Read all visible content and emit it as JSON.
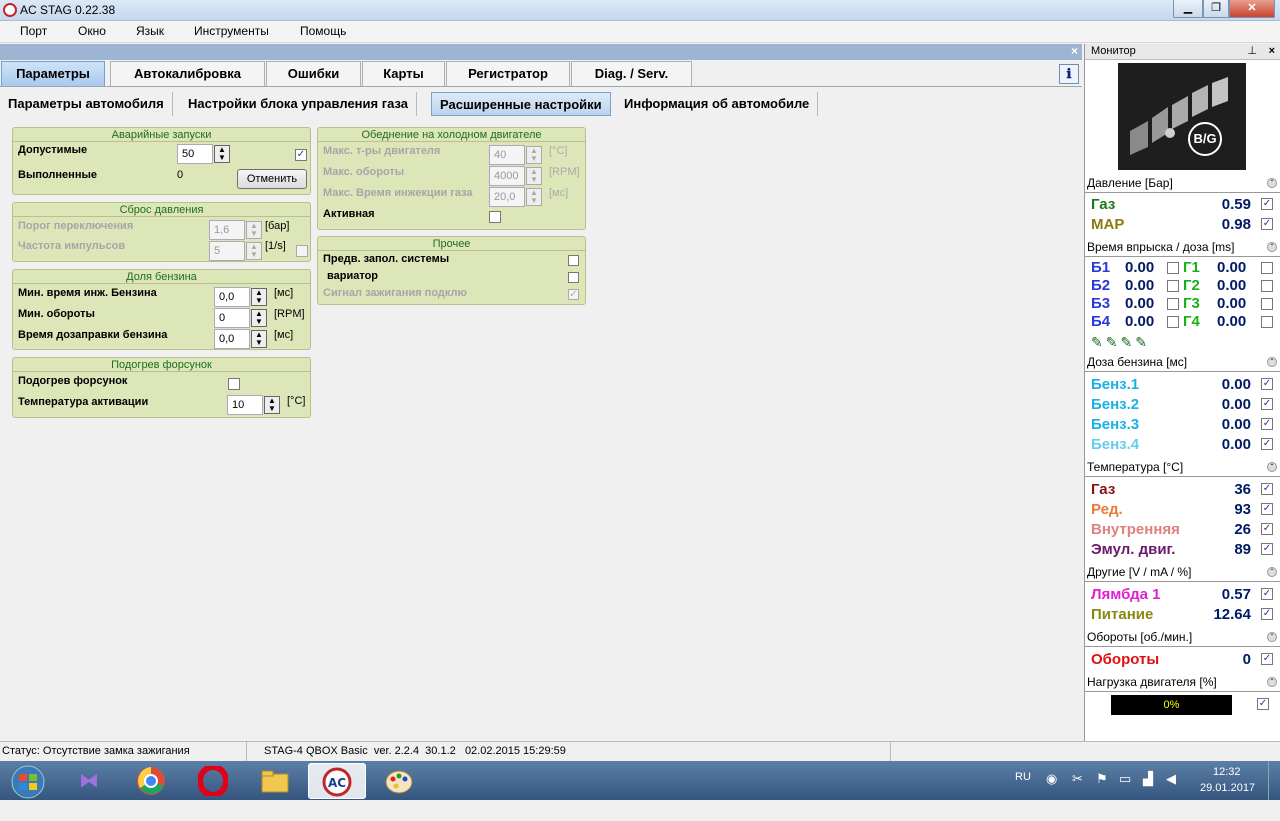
{
  "window": {
    "title": "AC STAG 0.22.38"
  },
  "menu": [
    "Порт",
    "Окно",
    "Язык",
    "Инструменты",
    "Помощь"
  ],
  "tabs": [
    "Параметры",
    "Автокалибровка",
    "Ошибки",
    "Карты",
    "Регистратор",
    "Diag. / Serv."
  ],
  "subtabs": [
    "Параметры автомобиля",
    "Настройки блока управления газа",
    "Расширенные настройки",
    "Информация об автомобиле"
  ],
  "emergency": {
    "title": "Аварийные запуски",
    "allowed_label": "Допустимые",
    "allowed_value": "50",
    "done_label": "Выполненные",
    "done_value": "0",
    "cancel_label": "Отменить"
  },
  "pressure_reset": {
    "title": "Сброс давления",
    "threshold_label": "Порог переключения",
    "threshold_value": "1,6",
    "threshold_unit": "[бар]",
    "freq_label": "Частота импульсов",
    "freq_value": "5",
    "freq_unit": "[1/s]"
  },
  "petrol_share": {
    "title": "Доля бензина",
    "min_inj_label": "Мин. время инж. Бензина",
    "min_inj_value": "0,0",
    "min_inj_unit": "[мс]",
    "min_rpm_label": "Мин. обороты",
    "min_rpm_value": "0",
    "min_rpm_unit": "[RPM]",
    "refuel_label": "Время дозаправки бензина",
    "refuel_value": "0,0",
    "refuel_unit": "[мс]"
  },
  "injector_heat": {
    "title": "Подогрев форсунок",
    "heat_label": "Подогрев форсунок",
    "temp_label": "Температура активации",
    "temp_value": "10",
    "temp_unit": "[°C]"
  },
  "cold_lean": {
    "title": "Обеднение на холодном двигателе",
    "temp_label": "Макс. т-ры двигателя",
    "temp_value": "40",
    "temp_unit": "[°C]",
    "rpm_label": "Макс. обороты",
    "rpm_value": "4000",
    "rpm_unit": "[RPM]",
    "inj_label": "Макс. Время инжекции газа",
    "inj_value": "20,0",
    "inj_unit": "[мс]",
    "active_label": "Активная"
  },
  "other": {
    "title": "Прочее",
    "prefill_label": "Предв. запол. системы",
    "variator_label": "вариатор",
    "ignition_label": "Сигнал зажигания подклю"
  },
  "monitor": {
    "title": "Монитор",
    "logo_text": "B/G",
    "pressure": {
      "title": "Давление [Бар]",
      "rows": [
        {
          "name": "Газ",
          "value": "0.59",
          "color": "#1a7a1a"
        },
        {
          "name": "MAP",
          "value": "0.98",
          "color": "#8a7a10"
        }
      ]
    },
    "injection": {
      "title": "Время впрыска / доза [ms]",
      "rows": [
        {
          "b": "Б1",
          "bv": "0.00",
          "g": "Г1",
          "gv": "0.00"
        },
        {
          "b": "Б2",
          "bv": "0.00",
          "g": "Г2",
          "gv": "0.00"
        },
        {
          "b": "Б3",
          "bv": "0.00",
          "g": "Г3",
          "gv": "0.00"
        },
        {
          "b": "Б4",
          "bv": "0.00",
          "g": "Г4",
          "gv": "0.00"
        }
      ]
    },
    "petrol_dose": {
      "title": "Доза бензина [мс]",
      "rows": [
        {
          "name": "Бенз.1",
          "value": "0.00",
          "color": "#1ab0e6"
        },
        {
          "name": "Бенз.2",
          "value": "0.00",
          "color": "#1ab0e6"
        },
        {
          "name": "Бенз.3",
          "value": "0.00",
          "color": "#1ab0e6"
        },
        {
          "name": "Бенз.4",
          "value": "0.00",
          "color": "#66ccee"
        }
      ]
    },
    "temperature": {
      "title": "Температура [°C]",
      "rows": [
        {
          "name": "Газ",
          "value": "36",
          "color": "#8a1010"
        },
        {
          "name": "Ред.",
          "value": "93",
          "color": "#e87a3a"
        },
        {
          "name": "Внутренняя",
          "value": "26",
          "color": "#e08080"
        },
        {
          "name": "Эмул. двиг.",
          "value": "89",
          "color": "#6a1a6a"
        }
      ]
    },
    "others": {
      "title": "Другие [V / mA / %]",
      "rows": [
        {
          "name": "Лямбда 1",
          "value": "0.57",
          "color": "#e020d0"
        },
        {
          "name": "Питание",
          "value": "12.64",
          "color": "#8a8a10"
        }
      ]
    },
    "rpm": {
      "title": "Обороты [об./мин.]",
      "rows": [
        {
          "name": "Обороты",
          "value": "0",
          "color": "#e01010"
        }
      ]
    },
    "load": {
      "title": "Нагрузка двигателя [%]",
      "value": "0%"
    }
  },
  "status": {
    "text": "Статус: Отсутствие замка зажигания",
    "device": "STAG-4 QBOX Basic  ver. 2.2.4  30.1.2   02.02.2015 15:29:59"
  },
  "taskbar": {
    "lang": "RU",
    "time": "12:32",
    "date": "29.01.2017"
  }
}
